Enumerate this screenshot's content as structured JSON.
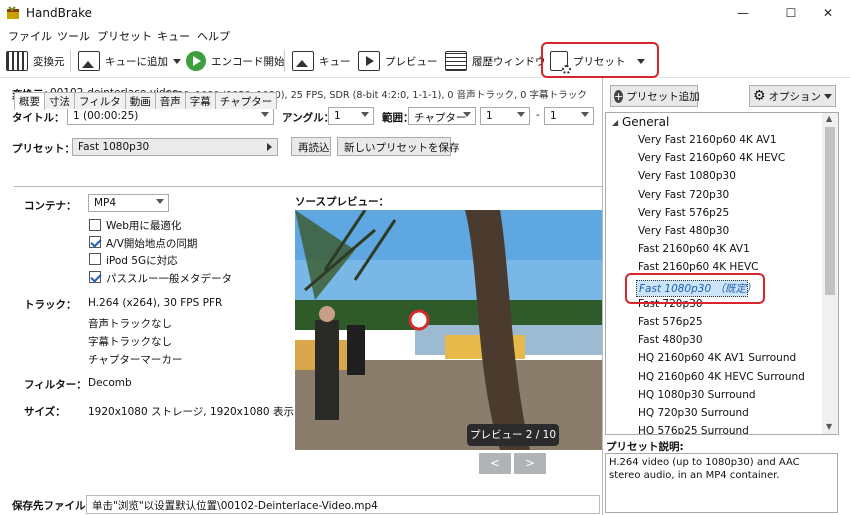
{
  "window": {
    "title": "HandBrake",
    "controls": [
      "—",
      "☐",
      "✕"
    ]
  },
  "menu": [
    "ファイル",
    "ツール",
    "プリセット",
    "キュー",
    "ヘルプ"
  ],
  "toolbar": {
    "source": "変換元",
    "add_queue": "キューに追加",
    "start": "エンコード開始",
    "queue": "キュー",
    "preview": "プレビュー",
    "activity": "履歴ウィンドウ",
    "presets": "プリセット"
  },
  "source": {
    "label": "変換元：",
    "name": "00102-deinterlace-video",
    "info": "1920x1080 (1920x1080), 25 FPS, SDR (8-bit 4:2:0, 1-1-1), 0 音声トラック, 0 字幕トラック"
  },
  "title_row": {
    "label": "タイトル：",
    "value": "1 (00:00:25)",
    "angle_label": "アングル：",
    "angle": "1",
    "range_label": "範囲：",
    "range_type": "チャプター",
    "range_from": "1",
    "dash": "-",
    "range_to": "1"
  },
  "preset_row": {
    "label": "プリセット：",
    "value": "Fast 1080p30",
    "reload": "再読込",
    "save_new": "新しいプリセットを保存"
  },
  "tabs": [
    "概要",
    "寸法",
    "フィルタ",
    "動画",
    "音声",
    "字幕",
    "チャプター"
  ],
  "summary": {
    "container_label": "コンテナ：",
    "container": "MP4",
    "options": [
      {
        "label": "Web用に最適化",
        "checked": false
      },
      {
        "label": "A/V開始地点の同期",
        "checked": true
      },
      {
        "label": "iPod 5Gに対応",
        "checked": false
      },
      {
        "label": "パススルー一般メタデータ",
        "checked": true
      }
    ],
    "tracks_label": "トラック：",
    "tracks": [
      "H.264 (x264), 30 FPS PFR",
      "音声トラックなし",
      "字幕トラックなし",
      "チャプターマーカー"
    ],
    "filters_label": "フィルター：",
    "filters": "Decomb",
    "size_label": "サイズ：",
    "size": "1920x1080 ストレージ, 1920x1080 表示"
  },
  "preview": {
    "label": "ソースプレビュー：",
    "counter": "プレビュー 2 / 10",
    "prev": "<",
    "next": ">"
  },
  "save": {
    "label": "保存先ファイル：",
    "path": "单击\"浏览\"以设置默认位置\\00102-Deinterlace-Video.mp4"
  },
  "right": {
    "add_preset": "プリセット追加",
    "options": "オプション",
    "group": "General",
    "presets": [
      "Very Fast 2160p60 4K AV1",
      "Very Fast 2160p60 4K HEVC",
      "Very Fast 1080p30",
      "Very Fast 720p30",
      "Very Fast 576p25",
      "Very Fast 480p30",
      "Fast 2160p60 4K AV1",
      "Fast 2160p60 4K HEVC",
      "Fast 1080p30 （既定）",
      "Fast 720p30",
      "Fast 576p25",
      "Fast 480p30",
      "HQ 2160p60 4K AV1 Surround",
      "HQ 2160p60 4K HEVC Surround",
      "HQ 1080p30 Surround",
      "HQ 720p30 Surround",
      "HQ 576p25 Surround"
    ],
    "selected_index": 8,
    "desc_label": "プリセット説明:",
    "desc": "H.264 video (up to 1080p30) and AAC stereo audio, in an MP4 container."
  },
  "colors": {
    "highlight": "#cce4f7",
    "red": "#d9232d",
    "selected_text": "#1a5fb4"
  }
}
